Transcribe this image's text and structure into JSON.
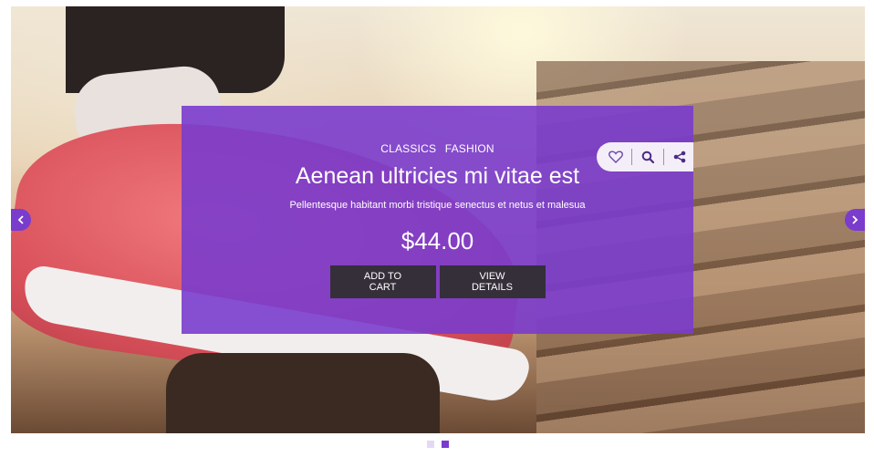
{
  "product": {
    "categories": [
      "CLASSICS",
      "FASHION"
    ],
    "title": "Aenean ultricies mi vitae est",
    "description": "Pellentesque habitant morbi tristique senectus et netus et malesua",
    "price": "$44.00",
    "add_to_cart_label": "ADD TO CART",
    "view_details_label": "VIEW DETAILS"
  },
  "actions": {
    "icons": [
      "heart-icon",
      "search-icon",
      "share-icon"
    ]
  },
  "slider": {
    "active_slide": 2,
    "slide_count": 2
  },
  "colors": {
    "accent": "#7a3ccd",
    "button_bg": "#352f3a",
    "toolbar_bg": "#f4eef8"
  }
}
